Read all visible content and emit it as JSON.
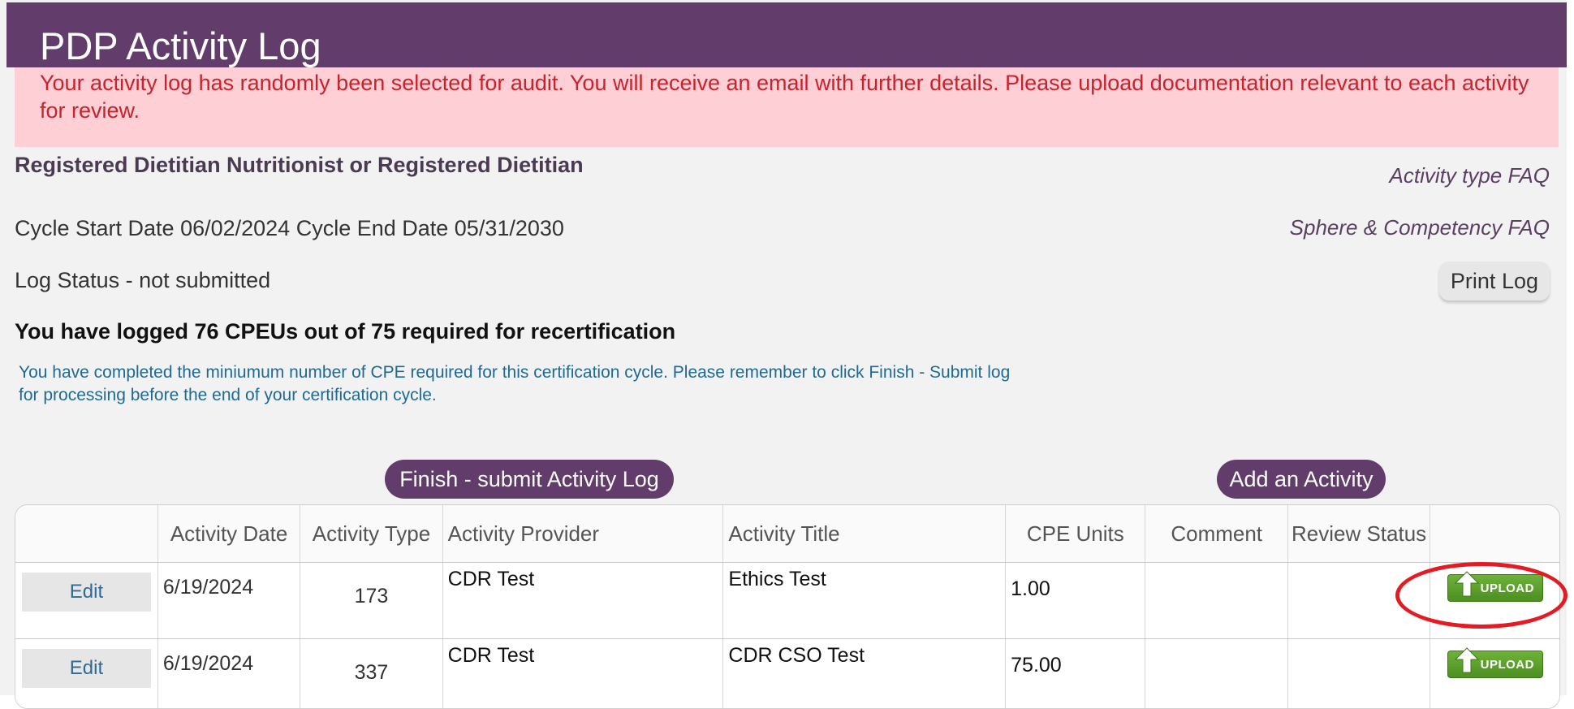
{
  "header": {
    "title": "PDP Activity Log"
  },
  "alert": {
    "text": "Your activity log has randomly been selected for audit.  You will receive an email with further details.  Please upload documentation relevant to each activity for review."
  },
  "credential": "Registered Dietitian Nutritionist or Registered Dietitian",
  "links": {
    "activity_type_faq": "Activity type FAQ",
    "sphere_faq": "Sphere & Competency FAQ"
  },
  "cycle": "Cycle Start Date 06/02/2024 Cycle End Date 05/31/2030",
  "log_status": "Log Status - not submitted",
  "print_log": "Print Log",
  "summary": "You have logged 76 CPEUs out of 75 required for recertification",
  "note": "You have completed the miniumum number of CPE required for this certification cycle.  Please remember to click Finish - Submit log for processing before the end of your certification cycle.",
  "buttons": {
    "finish": "Finish - submit Activity Log",
    "add": "Add an Activity"
  },
  "table": {
    "headers": [
      "",
      "Activity Date",
      "Activity Type",
      "Activity Provider",
      "Activity Title",
      "CPE Units",
      "Comment",
      "Review Status",
      ""
    ],
    "rows": [
      {
        "edit": "Edit",
        "date": "6/19/2024",
        "type": "173",
        "provider": "CDR Test",
        "title": "Ethics Test",
        "cpe": "1.00",
        "comment": "",
        "review": "",
        "upload": "UPLOAD"
      },
      {
        "edit": "Edit",
        "date": "6/19/2024",
        "type": "337",
        "provider": "CDR Test",
        "title": "CDR CSO Test",
        "cpe": "75.00",
        "comment": "",
        "review": "",
        "upload": "UPLOAD"
      }
    ]
  },
  "colors": {
    "brand_purple": "#623c6b",
    "alert_bg": "#fecfd4",
    "alert_text": "#c8222e",
    "note_blue": "#1f6a94",
    "upload_green": "#5ea22d",
    "highlight_red": "#e41b23"
  }
}
